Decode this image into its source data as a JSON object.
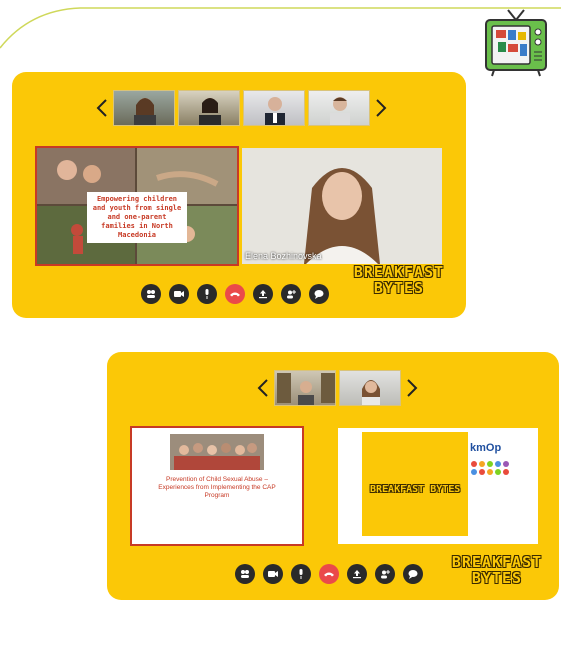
{
  "colors": {
    "panel": "#fbc807",
    "accent_line": "#cfd85a",
    "hangup": "#ea4a4a",
    "control": "#2a2a2a",
    "slide_red": "#c73a25"
  },
  "tv_logo": {
    "icon": "retro-tv-icon"
  },
  "call1": {
    "thumbnails": [
      "participant-1",
      "participant-2",
      "participant-3",
      "participant-4"
    ],
    "slide_caption": "Empowering children and youth from single and one-parent families in North Macedonia",
    "speaker_name": "Elena Bozhinovska",
    "controls": [
      "people-icon",
      "camera-icon",
      "mic-icon",
      "hangup-icon",
      "share-icon",
      "add-person-icon",
      "chat-icon"
    ],
    "brand_line1": "BREAKFAST",
    "brand_line2": "BYTES"
  },
  "call2": {
    "thumbnails": [
      "participant-1",
      "participant-2"
    ],
    "doc_title": "Prevention of Child Sexual Abuse – Experiences from Implementing the CAP Program",
    "doc_subtitle": "",
    "doc_logo": "",
    "yellow_slide_heading": "BREAKFAST BYTES",
    "yellow_slide_text": "",
    "kmop_logo": "kmOp",
    "kmop_subtext": "",
    "controls": [
      "people-icon",
      "camera-icon",
      "mic-icon",
      "hangup-icon",
      "share-icon",
      "add-person-icon",
      "chat-icon"
    ],
    "brand_line1": "BREAKFAST",
    "brand_line2": "BYTES"
  }
}
